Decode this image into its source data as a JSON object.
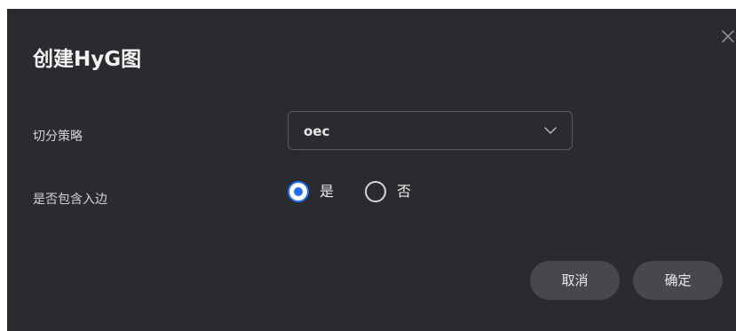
{
  "dialog": {
    "title": "创建HyG图",
    "close_icon": "close-icon"
  },
  "form": {
    "strategy": {
      "label": "切分策略",
      "value": "oec",
      "icon": "chevron-down-icon"
    },
    "include_in_edge": {
      "label": "是否包含入边",
      "options": [
        {
          "label": "是",
          "selected": true
        },
        {
          "label": "否",
          "selected": false
        }
      ]
    }
  },
  "buttons": {
    "cancel_label": "取消",
    "ok_label": "确定"
  },
  "colors": {
    "dialog_bg": "#2a2b2e",
    "accent": "#1f6fff",
    "button_bg": "#47484d"
  }
}
